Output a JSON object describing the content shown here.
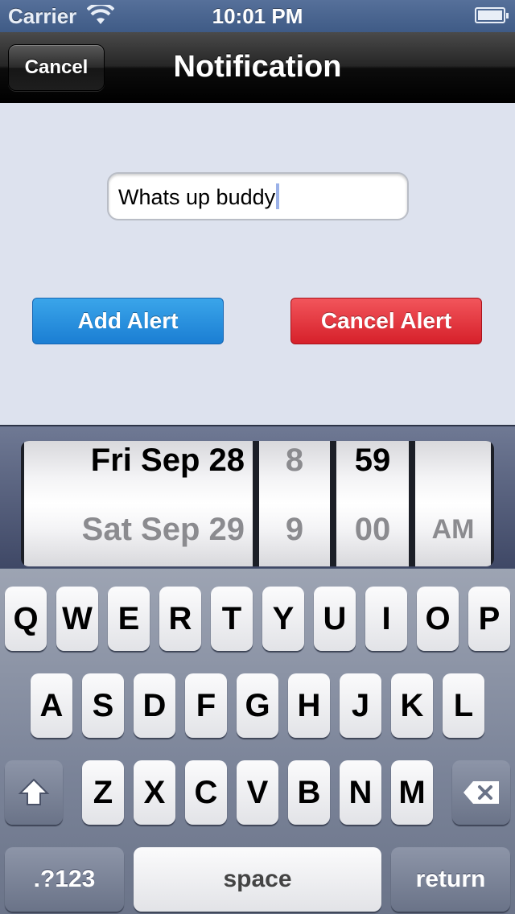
{
  "status": {
    "carrier": "Carrier",
    "time": "10:01 PM"
  },
  "nav": {
    "cancel_label": "Cancel",
    "title": "Notification"
  },
  "message_field": {
    "value": "Whats up buddy"
  },
  "buttons": {
    "add_alert": "Add Alert",
    "cancel_alert": "Cancel Alert"
  },
  "picker": {
    "date": [
      "Fri Sep 28",
      "Sat Sep 29"
    ],
    "hour": [
      "8",
      "9"
    ],
    "minute": [
      "59",
      "00"
    ],
    "ampm": "AM",
    "selected": {
      "date": "Fri Sep 28",
      "hour": "8",
      "minute": "59"
    }
  },
  "keyboard": {
    "row1": [
      "Q",
      "W",
      "E",
      "R",
      "T",
      "Y",
      "U",
      "I",
      "O",
      "P"
    ],
    "row2": [
      "A",
      "S",
      "D",
      "F",
      "G",
      "H",
      "J",
      "K",
      "L"
    ],
    "row3": [
      "Z",
      "X",
      "C",
      "V",
      "B",
      "N",
      "M"
    ],
    "numbers_key": ".?123",
    "space_key": "space",
    "return_key": "return"
  },
  "icons": {
    "wifi": "wifi-icon",
    "battery": "battery-icon",
    "shift": "shift-icon",
    "backspace": "backspace-icon"
  }
}
